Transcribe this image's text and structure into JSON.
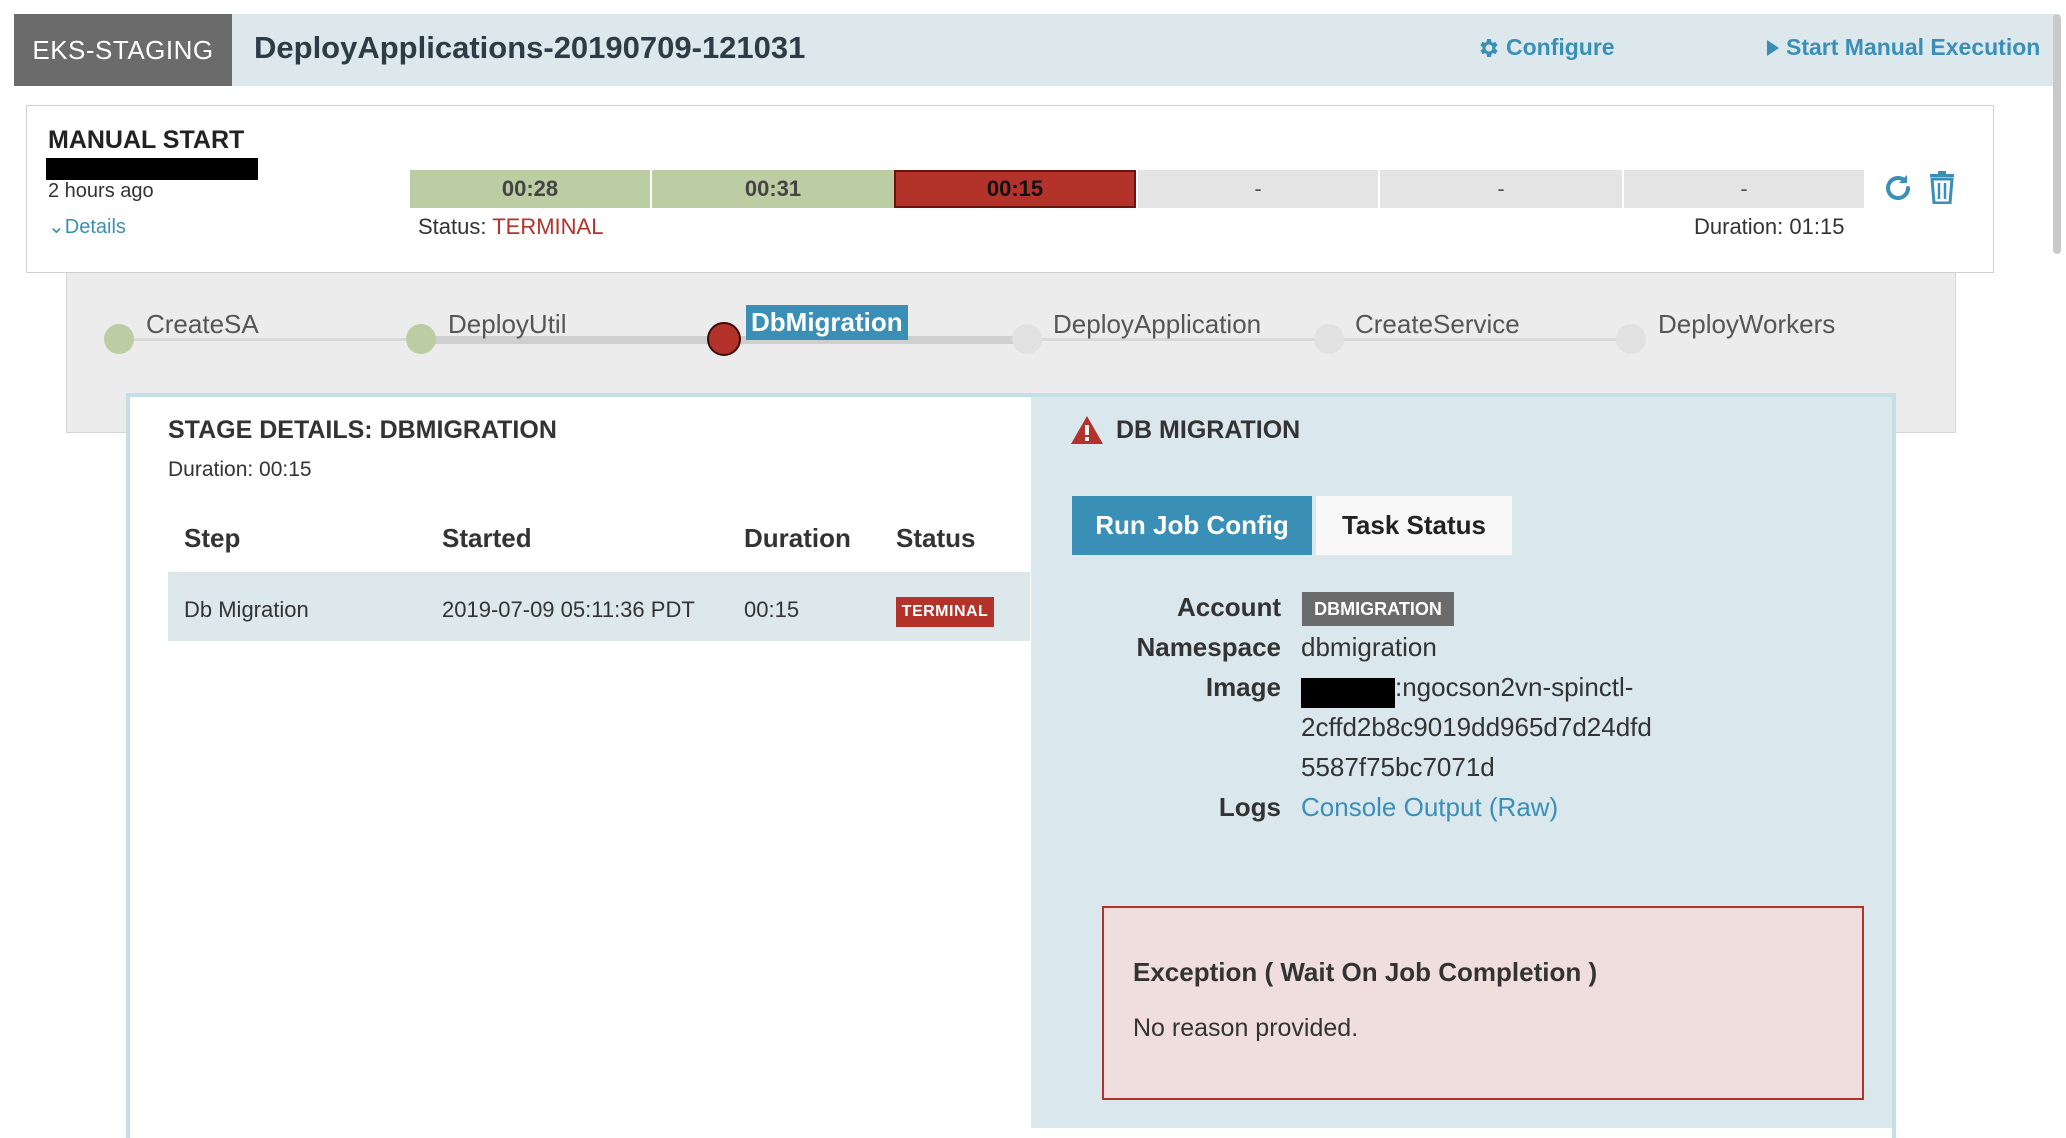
{
  "header": {
    "application": "EKS-STAGING",
    "pipeline_title": "DeployApplications-20190709-121031",
    "configure_label": "Configure",
    "start_label": "Start Manual Execution"
  },
  "execution": {
    "trigger": "MANUAL START",
    "time_ago": "2 hours ago",
    "details_label": "Details",
    "segments": [
      {
        "label": "00:28",
        "state": "succeeded"
      },
      {
        "label": "00:31",
        "state": "succeeded"
      },
      {
        "label": "00:15",
        "state": "terminal"
      },
      {
        "label": "-",
        "state": "not_started"
      },
      {
        "label": "-",
        "state": "not_started"
      },
      {
        "label": "-",
        "state": "not_started"
      }
    ],
    "status_prefix": "Status: ",
    "status_value": "TERMINAL",
    "duration": "Duration: 01:15"
  },
  "stages": [
    {
      "label": "CreateSA",
      "state": "succeeded"
    },
    {
      "label": "DeployUtil",
      "state": "succeeded"
    },
    {
      "label": "DbMigration",
      "state": "terminal",
      "selected": true
    },
    {
      "label": "DeployApplication",
      "state": "not_started"
    },
    {
      "label": "CreateService",
      "state": "not_started"
    },
    {
      "label": "DeployWorkers",
      "state": "not_started"
    }
  ],
  "stage_details": {
    "title": "STAGE DETAILS: DBMIGRATION",
    "duration": "Duration: 00:15",
    "columns": [
      "Step",
      "Started",
      "Duration",
      "Status"
    ],
    "rows": [
      {
        "step": "Db Migration",
        "started": "2019-07-09 05:11:36 PDT",
        "duration": "00:15",
        "status": "TERMINAL"
      }
    ]
  },
  "task_panel": {
    "title": "DB MIGRATION",
    "tabs": [
      "Run Job Config",
      "Task Status"
    ],
    "account_label": "Account",
    "account_value": "DBMIGRATION",
    "namespace_label": "Namespace",
    "namespace_value": "dbmigration",
    "image_label": "Image",
    "image_lines": [
      ":ngocson2vn-spinctl-",
      "2cffd2b8c9019dd965d7d24dfd",
      "5587f75bc7071d"
    ],
    "logs_label": "Logs",
    "logs_link": "Console Output (Raw)",
    "exception_title": "Exception ( Wait On Job Completion )",
    "exception_message": "No reason provided."
  },
  "colors": {
    "accent": "#3a8fb7",
    "succeeded": "#bccca3",
    "terminal": "#b3322a",
    "not_started": "#e4e4e4",
    "header_bg": "#dde8ec"
  }
}
